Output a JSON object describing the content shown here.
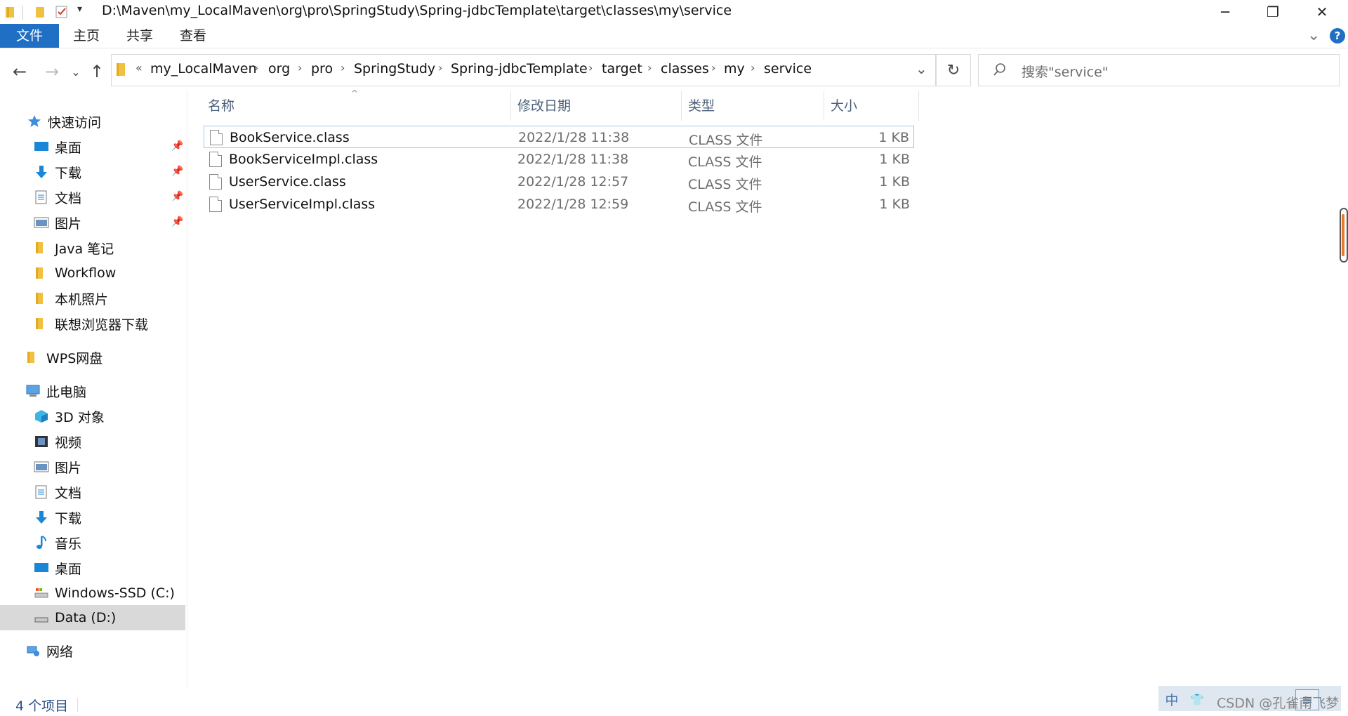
{
  "window": {
    "title": "D:\\Maven\\my_LocalMaven\\org\\pro\\SpringStudy\\Spring-jdbcTemplate\\target\\classes\\my\\service",
    "minimize": "─",
    "maximize": "❐",
    "close": "✕"
  },
  "ribbon": {
    "tabs": [
      "文件",
      "主页",
      "共享",
      "查看"
    ],
    "help": "?",
    "collapse": "⌄"
  },
  "nav": {
    "back": "←",
    "forward": "→",
    "recent": "⌄",
    "up": "↑"
  },
  "address": {
    "overflow": "«",
    "crumbs": [
      "my_LocalMaven",
      "org",
      "pro",
      "SpringStudy",
      "Spring-jdbcTemplate",
      "target",
      "classes",
      "my",
      "service"
    ],
    "separator": "›",
    "dropdown": "⌄",
    "refresh": "↻"
  },
  "search": {
    "placeholder": "搜索\"service\""
  },
  "sidebar": {
    "quick_access": "快速访问",
    "quick_items": [
      {
        "label": "桌面",
        "icon": "desktop-icon",
        "pinned": true
      },
      {
        "label": "下载",
        "icon": "download-icon",
        "pinned": true
      },
      {
        "label": "文档",
        "icon": "documents-icon",
        "pinned": true
      },
      {
        "label": "图片",
        "icon": "pictures-icon",
        "pinned": true
      },
      {
        "label": "Java 笔记",
        "icon": "folder-icon",
        "pinned": false
      },
      {
        "label": "Workflow",
        "icon": "folder-icon",
        "pinned": false
      },
      {
        "label": "本机照片",
        "icon": "folder-icon",
        "pinned": false
      },
      {
        "label": "联想浏览器下载",
        "icon": "folder-icon",
        "pinned": false
      }
    ],
    "wps": "WPS网盘",
    "this_pc": "此电脑",
    "pc_items": [
      {
        "label": "3D 对象",
        "icon": "3d-objects-icon"
      },
      {
        "label": "视频",
        "icon": "videos-icon"
      },
      {
        "label": "图片",
        "icon": "pictures-icon"
      },
      {
        "label": "文档",
        "icon": "documents-icon"
      },
      {
        "label": "下载",
        "icon": "download-icon"
      },
      {
        "label": "音乐",
        "icon": "music-icon"
      },
      {
        "label": "桌面",
        "icon": "desktop-icon"
      },
      {
        "label": "Windows-SSD (C:)",
        "icon": "drive-c-icon"
      },
      {
        "label": "Data (D:)",
        "icon": "drive-d-icon"
      }
    ],
    "network": "网络"
  },
  "columns": {
    "name": "名称",
    "date": "修改日期",
    "type": "类型",
    "size": "大小"
  },
  "files": [
    {
      "name": "BookService.class",
      "date": "2022/1/28 11:38",
      "type": "CLASS 文件",
      "size": "1 KB"
    },
    {
      "name": "BookServiceImpl.class",
      "date": "2022/1/28 11:38",
      "type": "CLASS 文件",
      "size": "1 KB"
    },
    {
      "name": "UserService.class",
      "date": "2022/1/28 12:57",
      "type": "CLASS 文件",
      "size": "1 KB"
    },
    {
      "name": "UserServiceImpl.class",
      "date": "2022/1/28 12:59",
      "type": "CLASS 文件",
      "size": "1 KB"
    }
  ],
  "status": {
    "item_count": "4 个项目"
  },
  "ime": {
    "mode": "中",
    "skin": "👕"
  },
  "watermark": "CSDN @孔雀南飞梦",
  "colors": {
    "file_tab": "#1f6fc5",
    "selection_border": "#99c9ef",
    "column_header": "#4c607a",
    "status_text": "#2a4f84"
  }
}
